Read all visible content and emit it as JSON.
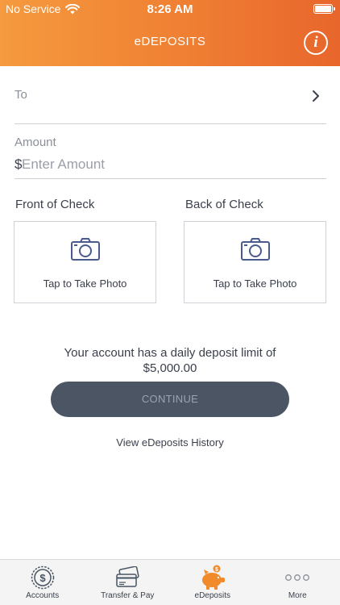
{
  "status_bar": {
    "carrier": "No Service",
    "time": "8:26 AM"
  },
  "header": {
    "title": "eDEPOSITS",
    "info_icon": "i"
  },
  "to_field": {
    "label": "To"
  },
  "amount": {
    "label": "Amount",
    "currency": "$",
    "placeholder": "Enter Amount",
    "value": ""
  },
  "checks": {
    "front": {
      "title": "Front of Check",
      "caption": "Tap to Take Photo"
    },
    "back": {
      "title": "Back of Check",
      "caption": "Tap to Take Photo"
    }
  },
  "limit": {
    "line1": "Your account has a daily deposit limit of",
    "line2": "$5,000.00"
  },
  "continue_label": "CONTINUE",
  "history_link": "View eDeposits History",
  "tabs": [
    {
      "label": "Accounts",
      "icon": "dollar-coin-icon",
      "active": false
    },
    {
      "label": "Transfer & Pay",
      "icon": "cards-icon",
      "active": false
    },
    {
      "label": "eDeposits",
      "icon": "piggy-bank-icon",
      "active": true
    },
    {
      "label": "More",
      "icon": "more-dots-icon",
      "active": false
    }
  ],
  "colors": {
    "header_start": "#f59a3e",
    "header_end": "#e8662c",
    "accent": "#f08a2a",
    "button_bg": "#4b5563",
    "button_text": "#9aa3b2",
    "icon_blue": "#4a5a8c"
  }
}
